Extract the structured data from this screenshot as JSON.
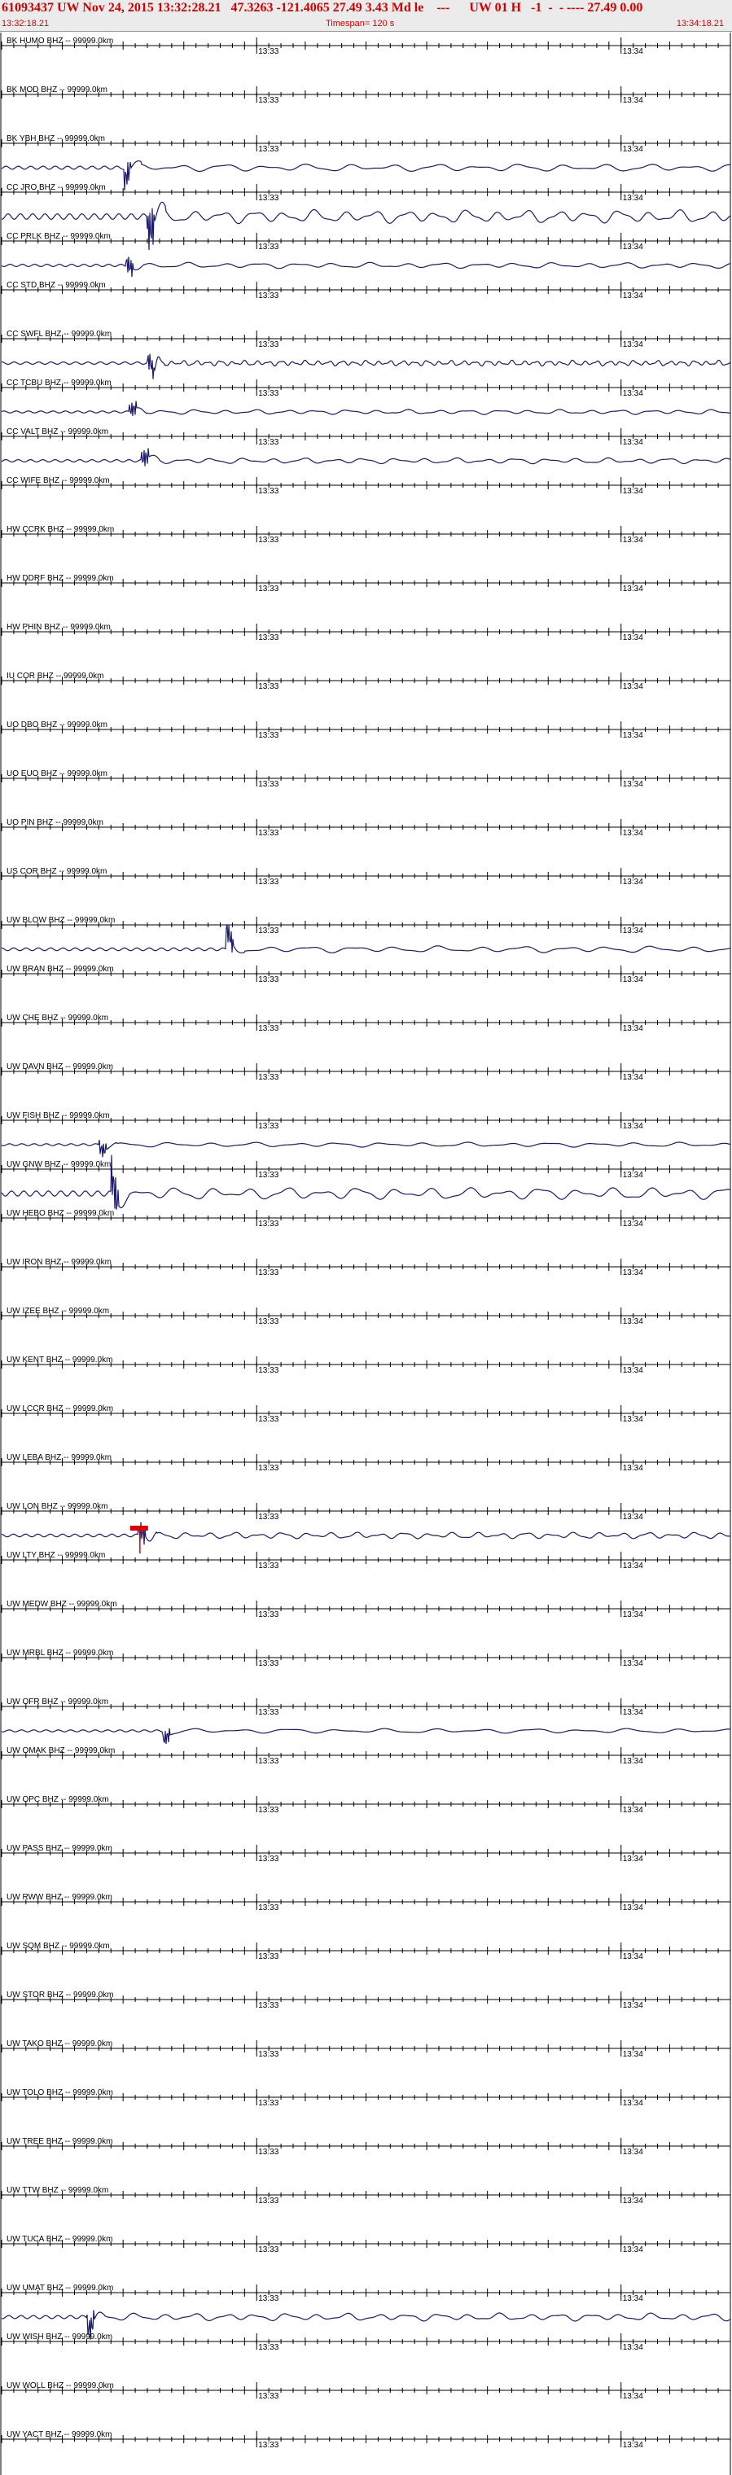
{
  "header": {
    "line1": "61093437 UW Nov 24, 2015 13:32:28.21   47.3263 -121.4065 27.49 3.43 Md le    ---      UW 01 H   -1  -  - ---- 27.49 0.00",
    "start_time": "13:32:18.21",
    "timespan": "Timespan= 120 s",
    "end_time": "13:34:18.21"
  },
  "colors": {
    "header_text": "#d40000",
    "header_bg": "#ebebeb",
    "trace": "#1a1a6e",
    "axis": "#000000",
    "pick": "#e00000"
  },
  "chart_data": {
    "type": "line",
    "title": "61093437 UW Nov 24, 2015 13:32:28.21",
    "x_unit": "s",
    "xlim": [
      0,
      120
    ],
    "minute_ticks": [
      {
        "t": 42.0,
        "label": "13:33"
      },
      {
        "t": 102.0,
        "label": "13:34"
      }
    ],
    "stations": [
      {
        "label": "BK HUMO BHZ -- 99999.0km",
        "onset": null,
        "amp": 0,
        "period": 5,
        "pick": false
      },
      {
        "label": "BK MOD BHZ -- 99999.0km",
        "onset": null,
        "amp": 0,
        "period": 5,
        "pick": false
      },
      {
        "label": "BK YBH BHZ -- 99999.0km",
        "onset": 20.0,
        "amp": 8,
        "period": 7,
        "pick": false
      },
      {
        "label": "CC JRO BHZ -- 99999.0km",
        "onset": 24.0,
        "amp": 14,
        "period": 5,
        "pick": false
      },
      {
        "label": "CC PRLK BHZ -- 99999.0km",
        "onset": 20.5,
        "amp": 6,
        "period": 6,
        "pick": false
      },
      {
        "label": "CC STD BHZ -- 99999.0km",
        "onset": null,
        "amp": 0,
        "period": 5,
        "pick": false
      },
      {
        "label": "CC SWFL BHZ -- 99999.0km",
        "onset": 24.0,
        "amp": 6,
        "period": 2,
        "pick": false
      },
      {
        "label": "CC TCBU BHZ -- 99999.0km",
        "onset": 21.0,
        "amp": 5,
        "period": 5,
        "pick": false
      },
      {
        "label": "CC VALT BHZ -- 99999.0km",
        "onset": 23.0,
        "amp": 6,
        "period": 5,
        "pick": false
      },
      {
        "label": "CC WIFE BHZ -- 99999.0km",
        "onset": null,
        "amp": 0,
        "period": 5,
        "pick": false
      },
      {
        "label": "HW CCRK BHZ -- 99999.0km",
        "onset": null,
        "amp": 0,
        "period": 5,
        "pick": false
      },
      {
        "label": "HW DDRF BHZ -- 99999.0km",
        "onset": null,
        "amp": 0,
        "period": 5,
        "pick": false
      },
      {
        "label": "HW PHIN BHZ -- 99999.0km",
        "onset": null,
        "amp": 0,
        "period": 5,
        "pick": false
      },
      {
        "label": "IU COR BHZ -- 99999.0km",
        "onset": null,
        "amp": 0,
        "period": 5,
        "pick": false
      },
      {
        "label": "UO DBO BHZ -- 99999.0km",
        "onset": null,
        "amp": 0,
        "period": 5,
        "pick": false
      },
      {
        "label": "UO EUO BHZ -- 99999.0km",
        "onset": null,
        "amp": 0,
        "period": 5,
        "pick": false
      },
      {
        "label": "UO PIN BHZ -- 99999.0km",
        "onset": null,
        "amp": 0,
        "period": 5,
        "pick": false
      },
      {
        "label": "US COR BHZ -- 99999.0km",
        "onset": null,
        "amp": 0,
        "period": 5,
        "pick": false
      },
      {
        "label": "UW BLOW BHZ -- 99999.0km",
        "onset": 37.0,
        "amp": 7,
        "period": 7,
        "pick": false
      },
      {
        "label": "UW BRAN BHZ -- 99999.0km",
        "onset": null,
        "amp": 0,
        "period": 5,
        "pick": false
      },
      {
        "label": "UW CHE BHZ -- 99999.0km",
        "onset": null,
        "amp": 0,
        "period": 5,
        "pick": false
      },
      {
        "label": "UW DAVN BHZ -- 99999.0km",
        "onset": null,
        "amp": 0,
        "period": 5,
        "pick": false
      },
      {
        "label": "UW FISH BHZ -- 99999.0km",
        "onset": 16.0,
        "amp": 5,
        "period": 7,
        "pick": false
      },
      {
        "label": "UW GNW BHZ -- 99999.0km",
        "onset": 18.0,
        "amp": 13,
        "period": 6,
        "pick": false
      },
      {
        "label": "UW HEBO BHZ -- 99999.0km",
        "onset": null,
        "amp": 0,
        "period": 5,
        "pick": false
      },
      {
        "label": "UW IRON BHZ -- 99999.0km",
        "onset": null,
        "amp": 0,
        "period": 5,
        "pick": false
      },
      {
        "label": "UW IZEE BHZ -- 99999.0km",
        "onset": null,
        "amp": 0,
        "period": 5,
        "pick": false
      },
      {
        "label": "UW KENT BHZ -- 99999.0km",
        "onset": null,
        "amp": 0,
        "period": 5,
        "pick": false
      },
      {
        "label": "UW LCCR BHZ -- 99999.0km",
        "onset": null,
        "amp": 0,
        "period": 5,
        "pick": false
      },
      {
        "label": "UW LEBA BHZ -- 99999.0km",
        "onset": null,
        "amp": 0,
        "period": 5,
        "pick": false
      },
      {
        "label": "UW LON BHZ -- 99999.0km",
        "onset": 22.5,
        "amp": 7,
        "period": 4,
        "pick": true
      },
      {
        "label": "UW LTY BHZ -- 99999.0km",
        "onset": null,
        "amp": 0,
        "period": 5,
        "pick": false
      },
      {
        "label": "UW MEDW BHZ -- 99999.0km",
        "onset": null,
        "amp": 0,
        "period": 5,
        "pick": false
      },
      {
        "label": "UW MRBL BHZ -- 99999.0km",
        "onset": null,
        "amp": 0,
        "period": 5,
        "pick": false
      },
      {
        "label": "UW OFR BHZ -- 99999.0km",
        "onset": 26.5,
        "amp": 5,
        "period": 8,
        "pick": false
      },
      {
        "label": "UW OMAK BHZ -- 99999.0km",
        "onset": null,
        "amp": 0,
        "period": 5,
        "pick": false
      },
      {
        "label": "UW OPC BHZ -- 99999.0km",
        "onset": null,
        "amp": 0,
        "period": 5,
        "pick": false
      },
      {
        "label": "UW PASS BHZ -- 99999.0km",
        "onset": null,
        "amp": 0,
        "period": 5,
        "pick": false
      },
      {
        "label": "UW RWW BHZ -- 99999.0km",
        "onset": null,
        "amp": 0,
        "period": 5,
        "pick": false
      },
      {
        "label": "UW SQM BHZ -- 99999.0km",
        "onset": null,
        "amp": 0,
        "period": 5,
        "pick": false
      },
      {
        "label": "UW STOR BHZ -- 99999.0km",
        "onset": null,
        "amp": 0,
        "period": 5,
        "pick": false
      },
      {
        "label": "UW TAKO BHZ -- 99999.0km",
        "onset": null,
        "amp": 0,
        "period": 5,
        "pick": false
      },
      {
        "label": "UW TOLO BHZ -- 99999.0km",
        "onset": null,
        "amp": 0,
        "period": 5,
        "pick": false
      },
      {
        "label": "UW TREE BHZ -- 99999.0km",
        "onset": null,
        "amp": 0,
        "period": 5,
        "pick": false
      },
      {
        "label": "UW TTW BHZ -- 99999.0km",
        "onset": null,
        "amp": 0,
        "period": 5,
        "pick": false
      },
      {
        "label": "UW TUCA BHZ -- 99999.0km",
        "onset": null,
        "amp": 0,
        "period": 5,
        "pick": false
      },
      {
        "label": "UW UMAT BHZ -- 99999.0km",
        "onset": 14.0,
        "amp": 8,
        "period": 5,
        "pick": false
      },
      {
        "label": "UW WISH BHZ -- 99999.0km",
        "onset": null,
        "amp": 0,
        "period": 5,
        "pick": false
      },
      {
        "label": "UW WOLL BHZ -- 99999.0km",
        "onset": null,
        "amp": 0,
        "period": 5,
        "pick": false
      },
      {
        "label": "UW YACT BHZ -- 99999.0km",
        "onset": null,
        "amp": 0,
        "period": 5,
        "pick": false
      }
    ]
  }
}
